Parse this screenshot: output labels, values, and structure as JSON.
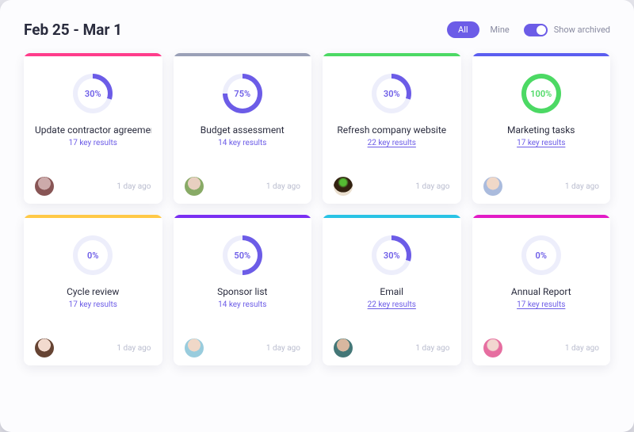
{
  "header": {
    "date_range": "Feb 25 - Mar 1",
    "filter_all": "All",
    "filter_mine": "Mine",
    "archive_label": "Show archived",
    "archive_on": true
  },
  "colors": {
    "purple": "#6c5ce7",
    "accents": {
      "pink": "#ff3d8b",
      "grey": "#9aa0b7",
      "green": "#4cd964",
      "indigo": "#5b5ef0",
      "yellow": "#ffc947",
      "violet": "#7a2ff2",
      "cyan": "#29c3e5",
      "magenta": "#e21bc6"
    }
  },
  "cards": [
    {
      "accent": "pink",
      "progress_pct": 30,
      "ring_color": "#6c5ce7",
      "title": "Update contractor agreemen",
      "results_text": "17 key results",
      "underline": false,
      "avatar": "av-1",
      "timestamp": "1 day ago"
    },
    {
      "accent": "grey",
      "progress_pct": 75,
      "ring_color": "#6c5ce7",
      "title": "Budget assessment",
      "results_text": "14 key results",
      "underline": false,
      "avatar": "av-2",
      "timestamp": "1 day ago"
    },
    {
      "accent": "green",
      "progress_pct": 30,
      "ring_color": "#6c5ce7",
      "title": "Refresh company website",
      "results_text": "22 key results",
      "underline": true,
      "avatar": "av-3",
      "timestamp": "1 day ago"
    },
    {
      "accent": "indigo",
      "progress_pct": 100,
      "ring_color": "#4cd964",
      "title": "Marketing tasks",
      "results_text": "17 key results",
      "underline": true,
      "avatar": "av-4",
      "timestamp": "1 day ago"
    },
    {
      "accent": "yellow",
      "progress_pct": 0,
      "ring_color": "#6c5ce7",
      "title": "Cycle review",
      "results_text": "17 key results",
      "underline": false,
      "avatar": "av-5",
      "timestamp": "1 day ago"
    },
    {
      "accent": "violet",
      "progress_pct": 50,
      "ring_color": "#6c5ce7",
      "title": "Sponsor list",
      "results_text": "14 key results",
      "underline": false,
      "avatar": "av-6",
      "timestamp": "1 day ago"
    },
    {
      "accent": "cyan",
      "progress_pct": 30,
      "ring_color": "#6c5ce7",
      "title": "Email",
      "results_text": "22 key results",
      "underline": true,
      "avatar": "av-7",
      "timestamp": "1 day ago"
    },
    {
      "accent": "magenta",
      "progress_pct": 0,
      "ring_color": "#6c5ce7",
      "title": "Annual Report",
      "results_text": "17 key results",
      "underline": true,
      "avatar": "av-8",
      "timestamp": "1 day ago"
    }
  ]
}
